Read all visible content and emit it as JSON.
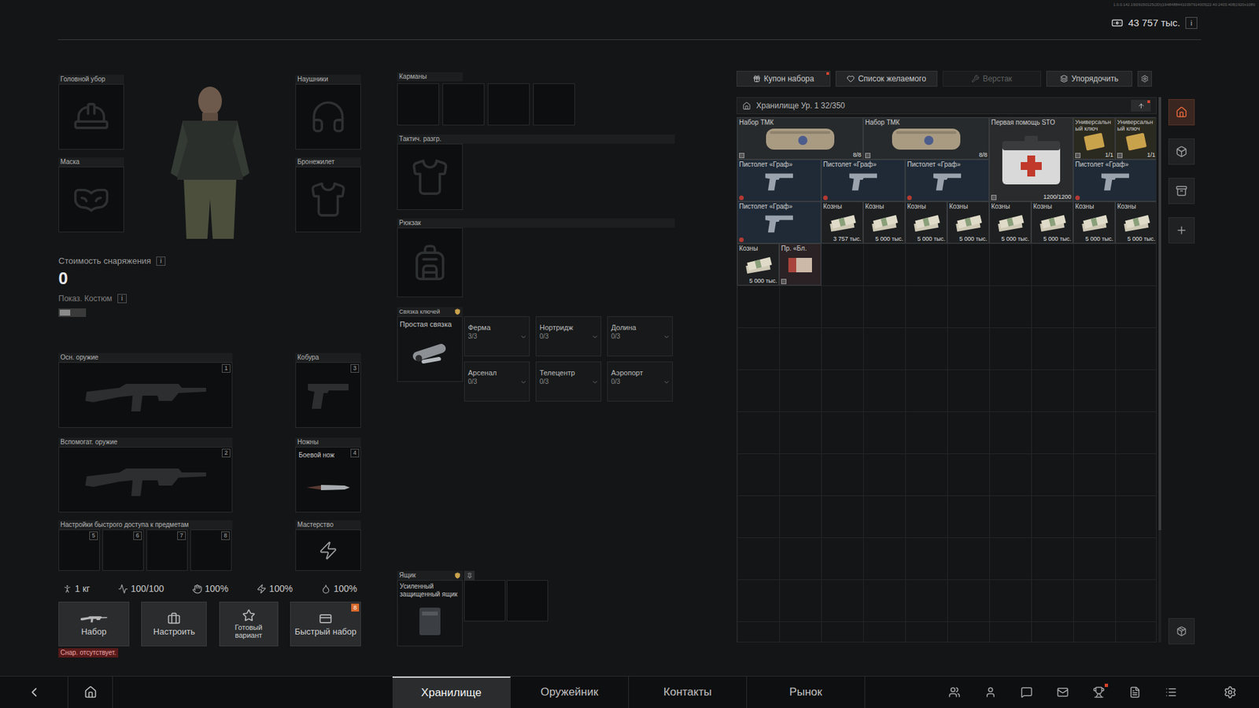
{
  "top_bar": {
    "version": "1.0.0.142.19|09150125(2D)|19484884410397914005|22:40:2403:408|1920x1080",
    "currency": "43 757 тыс.",
    "info": "i"
  },
  "equipment": {
    "left": [
      {
        "label": "Головной убор",
        "kind": "head"
      },
      {
        "label": "Маска",
        "kind": "mask"
      }
    ],
    "right": [
      {
        "label": "Наушники",
        "kind": "headphones"
      },
      {
        "label": "Бронежилет",
        "kind": "vest"
      }
    ],
    "cost": {
      "label": "Стоимость снаряжения",
      "info": "i",
      "value": "0"
    },
    "costume": {
      "label": "Показ. Костюм",
      "info": "i",
      "on": false
    },
    "primary": {
      "label": "Осн. оружие",
      "key": "1"
    },
    "secondary": {
      "label": "Вспомогат. оружие",
      "key": "2"
    },
    "holster": {
      "label": "Кобура",
      "key": "3"
    },
    "sheath": {
      "label": "Ножны",
      "key": "4",
      "item": "Боевой нож"
    },
    "quick_access": {
      "label": "Настройки быстрого доступа к предметам",
      "slots": [
        "5",
        "6",
        "7",
        "8"
      ]
    },
    "mastery": {
      "label": "Мастерство"
    },
    "stats": [
      {
        "kind": "weight",
        "value": "1 кг"
      },
      {
        "kind": "stamina",
        "value": "100/100"
      },
      {
        "kind": "hands",
        "value": "100%"
      },
      {
        "kind": "energy",
        "value": "100%"
      },
      {
        "kind": "hydration",
        "value": "100%"
      }
    ],
    "actions": [
      {
        "kind": "kit",
        "label": "Набор",
        "warning": "Снар. отсутствует."
      },
      {
        "kind": "configure",
        "label": "Настроить"
      },
      {
        "kind": "preset",
        "label": "Готовый вариант"
      },
      {
        "kind": "quick",
        "label": "Быстрый набор",
        "badge": "8"
      }
    ]
  },
  "gear": {
    "pockets": {
      "label": "Карманы",
      "slots": [
        {
          "empty": true
        },
        {
          "empty": true
        },
        {
          "empty": true
        },
        {
          "empty": true
        }
      ]
    },
    "rig": {
      "label": "Тактич. разгр."
    },
    "backpack": {
      "label": "Рюкзак"
    },
    "keychain": {
      "label": "Связка ключей",
      "item": "Простая связка",
      "sections": [
        {
          "name": "Ферма",
          "count": "3/3"
        },
        {
          "name": "Нортридж",
          "count": "0/3"
        },
        {
          "name": "Долина",
          "count": "0/3"
        },
        {
          "name": "Арсенал",
          "count": "0/3"
        },
        {
          "name": "Телецентр",
          "count": "0/3"
        },
        {
          "name": "Аэропорт",
          "count": "0/3"
        }
      ]
    },
    "case": {
      "label": "Ящик",
      "item": "Усиленный защищенный ящик",
      "slots": [
        {
          "empty": true
        },
        {
          "empty": true
        }
      ]
    }
  },
  "stash": {
    "toolbar": [
      {
        "kind": "coupon",
        "label": "Купон набора",
        "disabled": false,
        "badge": true
      },
      {
        "kind": "wishlist",
        "label": "Список желаемого",
        "disabled": false,
        "badge": false
      },
      {
        "kind": "workbench",
        "label": "Верстак",
        "disabled": true,
        "badge": false
      },
      {
        "kind": "sort",
        "label": "Упорядочить",
        "disabled": false,
        "badge": false
      }
    ],
    "title": "Хранилище Ур. 1 32/350",
    "items": [
      {
        "kind": "kit",
        "name": "Набор ТМК",
        "count": "8/8"
      },
      {
        "kind": "kit",
        "name": "Набор ТМК",
        "count": "8/8"
      },
      {
        "kind": "medkit",
        "name": "Первая помощь STO",
        "count": "1200/1200"
      },
      {
        "kind": "key",
        "name": "Универсальный ключ",
        "count": "1/1"
      },
      {
        "kind": "key",
        "name": "Универсальный ключ",
        "count": "1/1"
      },
      {
        "kind": "pistol",
        "name": "Пистолет «Граф»",
        "count": ""
      },
      {
        "kind": "pistol",
        "name": "Пистолет «Граф»",
        "count": ""
      },
      {
        "kind": "pistol",
        "name": "Пистолет «Граф»",
        "count": ""
      },
      {
        "kind": "pistol",
        "name": "Пистолет «Граф»",
        "count": ""
      },
      {
        "kind": "pistol",
        "name": "Пистолет «Граф»",
        "count": ""
      },
      {
        "kind": "money",
        "name": "Козны",
        "count": "3 757 тыс."
      },
      {
        "kind": "money",
        "name": "Козны",
        "count": "5 000 тыс."
      },
      {
        "kind": "money",
        "name": "Козны",
        "count": "5 000 тыс."
      },
      {
        "kind": "money",
        "name": "Козны",
        "count": "5 000 тыс."
      },
      {
        "kind": "money",
        "name": "Козны",
        "count": "5 000 тыс."
      },
      {
        "kind": "money",
        "name": "Козны",
        "count": "5 000 тыс."
      },
      {
        "kind": "money",
        "name": "Козны",
        "count": "5 000 тыс."
      },
      {
        "kind": "money",
        "name": "Козны",
        "count": "5 000 тыс."
      },
      {
        "kind": "money",
        "name": "Козны",
        "count": "5 000 тыс."
      },
      {
        "kind": "note",
        "name": "Пр. «Бл.",
        "count": ""
      }
    ]
  },
  "sidebar": [
    {
      "kind": "home",
      "selected": true
    },
    {
      "kind": "box",
      "selected": false
    },
    {
      "kind": "archive",
      "selected": false
    },
    {
      "kind": "add",
      "selected": false
    }
  ],
  "sidebar_bottom": {
    "kind": "settings"
  },
  "bottom_nav": {
    "tabs": [
      {
        "label": "Хранилище",
        "selected": true
      },
      {
        "label": "Оружейник",
        "selected": false
      },
      {
        "label": "Контакты",
        "selected": false
      },
      {
        "label": "Рынок",
        "selected": false
      }
    ],
    "icons": [
      {
        "kind": "friends",
        "badge": false
      },
      {
        "kind": "profile",
        "badge": false
      },
      {
        "kind": "chat",
        "badge": false
      },
      {
        "kind": "mail",
        "badge": false
      },
      {
        "kind": "achievements",
        "badge": true
      },
      {
        "kind": "tasks",
        "badge": false
      },
      {
        "kind": "list",
        "badge": false
      }
    ]
  }
}
